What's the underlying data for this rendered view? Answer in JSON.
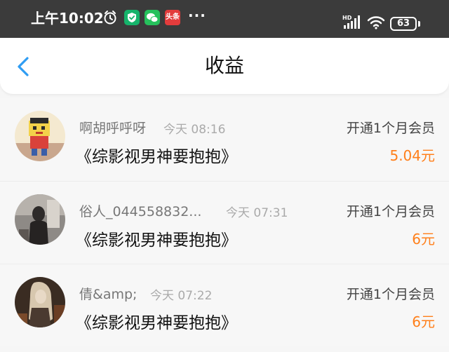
{
  "status_bar": {
    "time": "上午10:02",
    "app_badge": "头条",
    "more": "···",
    "network": "HD",
    "battery": "63"
  },
  "header": {
    "title": "收益"
  },
  "items": [
    {
      "username": "啊胡呼呼呀",
      "time": "今天 08:16",
      "action": "开通1个月会员",
      "book": "《综影视男神要抱抱》",
      "amount": "5.04元",
      "avatar": "cartoon-avatar"
    },
    {
      "username": "俗人_044558832...",
      "time": "今天 07:31",
      "action": "开通1个月会员",
      "book": "《综影视男神要抱抱》",
      "amount": "6元",
      "avatar": "photo-avatar"
    },
    {
      "username": "倩&amp;",
      "time": "今天 07:22",
      "action": "开通1个月会员",
      "book": "《综影视男神要抱抱》",
      "amount": "6元",
      "avatar": "photo-avatar"
    }
  ],
  "colors": {
    "accent": "#2f9df3",
    "amount": "#ff7f1a",
    "status_bar": "#3b3b3b"
  }
}
